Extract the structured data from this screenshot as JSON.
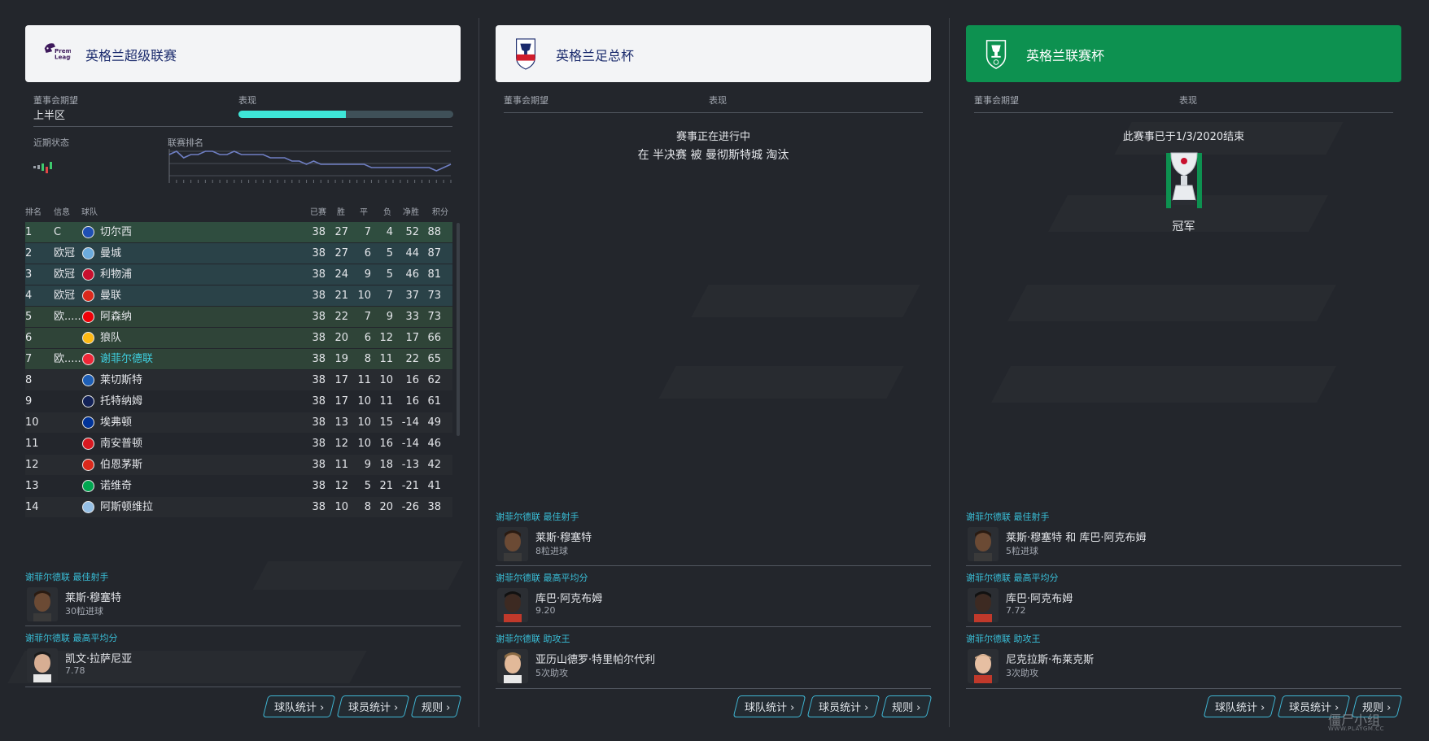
{
  "colors": {
    "background": "#23262c",
    "header_light": "#f3f4f6",
    "header_green": "#0d9150",
    "accent_cyan": "#3ee6d8",
    "section_title_blue": "#39bfd8",
    "highlight_row_green": "#2f4d3f",
    "highlight_row_teal": "#2a4248"
  },
  "premier_league": {
    "title": "英格兰超级联赛",
    "logo_text": "Premier League",
    "board_expectation_label": "董事会期望",
    "board_expectation_value": "上半区",
    "performance_label": "表现",
    "performance_fraction": 0.5,
    "recent_form_label": "近期状态",
    "league_position_label": "联赛排名",
    "position_history": [
      2,
      1,
      3,
      2,
      2,
      1,
      1,
      2,
      2,
      1,
      2,
      2,
      2,
      2,
      3,
      3,
      3,
      4,
      4,
      5,
      4,
      5,
      5,
      5,
      5,
      5,
      5,
      5,
      6,
      6,
      6,
      6,
      6,
      6,
      6,
      6,
      6,
      7,
      6,
      5
    ],
    "table_headers": {
      "pos": "排名",
      "info": "信息",
      "team": "球队",
      "played": "已赛",
      "won": "胜",
      "drawn": "平",
      "lost": "负",
      "gd": "净胜",
      "pts": "积分"
    },
    "table_rows": [
      {
        "pos": "1",
        "info": "C",
        "team": "切尔西",
        "played": "38",
        "won": "27",
        "drawn": "7",
        "lost": "4",
        "gd": "52",
        "pts": "88",
        "badge_color": "#1f4fb3"
      },
      {
        "pos": "2",
        "info": "欧冠",
        "team": "曼城",
        "played": "38",
        "won": "27",
        "drawn": "6",
        "lost": "5",
        "gd": "44",
        "pts": "87",
        "badge_color": "#6cabdd"
      },
      {
        "pos": "3",
        "info": "欧冠",
        "team": "利物浦",
        "played": "38",
        "won": "24",
        "drawn": "9",
        "lost": "5",
        "gd": "46",
        "pts": "81",
        "badge_color": "#c8102e"
      },
      {
        "pos": "4",
        "info": "欧冠",
        "team": "曼联",
        "played": "38",
        "won": "21",
        "drawn": "10",
        "lost": "7",
        "gd": "37",
        "pts": "73",
        "badge_color": "#da291c"
      },
      {
        "pos": "5",
        "info": "欧.....",
        "team": "阿森纳",
        "played": "38",
        "won": "22",
        "drawn": "7",
        "lost": "9",
        "gd": "33",
        "pts": "73",
        "badge_color": "#ef0107"
      },
      {
        "pos": "6",
        "info": "",
        "team": "狼队",
        "played": "38",
        "won": "20",
        "drawn": "6",
        "lost": "12",
        "gd": "17",
        "pts": "66",
        "badge_color": "#fdb913"
      },
      {
        "pos": "7",
        "info": "欧.....",
        "team": "谢菲尔德联",
        "played": "38",
        "won": "19",
        "drawn": "8",
        "lost": "11",
        "gd": "22",
        "pts": "65",
        "badge_color": "#ee2737"
      },
      {
        "pos": "8",
        "info": "",
        "team": "莱切斯特",
        "played": "38",
        "won": "17",
        "drawn": "11",
        "lost": "10",
        "gd": "16",
        "pts": "62",
        "badge_color": "#1e5fb6"
      },
      {
        "pos": "9",
        "info": "",
        "team": "托特纳姆",
        "played": "38",
        "won": "17",
        "drawn": "10",
        "lost": "11",
        "gd": "16",
        "pts": "61",
        "badge_color": "#132257"
      },
      {
        "pos": "10",
        "info": "",
        "team": "埃弗顿",
        "played": "38",
        "won": "13",
        "drawn": "10",
        "lost": "15",
        "gd": "-14",
        "pts": "49",
        "badge_color": "#003399"
      },
      {
        "pos": "11",
        "info": "",
        "team": "南安普顿",
        "played": "38",
        "won": "12",
        "drawn": "10",
        "lost": "16",
        "gd": "-14",
        "pts": "46",
        "badge_color": "#d71920"
      },
      {
        "pos": "12",
        "info": "",
        "team": "伯恩茅斯",
        "played": "38",
        "won": "11",
        "drawn": "9",
        "lost": "18",
        "gd": "-13",
        "pts": "42",
        "badge_color": "#da291c"
      },
      {
        "pos": "13",
        "info": "",
        "team": "诺维奇",
        "played": "38",
        "won": "12",
        "drawn": "5",
        "lost": "21",
        "gd": "-21",
        "pts": "41",
        "badge_color": "#00a650"
      },
      {
        "pos": "14",
        "info": "",
        "team": "阿斯顿维拉",
        "played": "38",
        "won": "10",
        "drawn": "8",
        "lost": "20",
        "gd": "-26",
        "pts": "38",
        "badge_color": "#95bfe5"
      }
    ],
    "top_scorer_title": "谢菲尔德联 最佳射手",
    "top_scorer_name": "莱斯·穆塞特",
    "top_scorer_stat": "30粒进球",
    "top_rating_title": "谢菲尔德联 最高平均分",
    "top_rating_name": "凯文·拉萨尼亚",
    "top_rating_stat": "7.78",
    "buttons": [
      "球队统计",
      "球员统计",
      "规则"
    ]
  },
  "fa_cup": {
    "title": "英格兰足总杯",
    "board_expectation_label": "董事会期望",
    "performance_label": "表现",
    "status_line1": "赛事正在进行中",
    "status_line2": "在 半决赛 被 曼彻斯特城 淘汰",
    "top_scorer_title": "谢菲尔德联 最佳射手",
    "top_scorer_name": "莱斯·穆塞特",
    "top_scorer_stat": "8粒进球",
    "top_rating_title": "谢菲尔德联 最高平均分",
    "top_rating_name": "库巴·阿克布姆",
    "top_rating_stat": "9.20",
    "top_assist_title": "谢菲尔德联 助攻王",
    "top_assist_name": "亚历山德罗·特里帕尔代利",
    "top_assist_stat": "5次助攻",
    "buttons": [
      "球队统计",
      "球员统计",
      "规则"
    ]
  },
  "league_cup": {
    "title": "英格兰联赛杯",
    "board_expectation_label": "董事会期望",
    "performance_label": "表现",
    "status_line1": "此赛事已于1/3/2020结束",
    "result": "冠军",
    "top_scorer_title": "谢菲尔德联 最佳射手",
    "top_scorer_name": "莱斯·穆塞特 和 库巴·阿克布姆",
    "top_scorer_stat": "5粒进球",
    "top_rating_title": "谢菲尔德联 最高平均分",
    "top_rating_name": "库巴·阿克布姆",
    "top_rating_stat": "7.72",
    "top_assist_title": "谢菲尔德联 助攻王",
    "top_assist_name": "尼克拉斯·布莱克斯",
    "top_assist_stat": "3次助攻",
    "buttons": [
      "球队统计",
      "球员统计",
      "规则"
    ]
  },
  "watermark": {
    "text": "僵尸小组",
    "url": "WWW.PLAYGM.CC"
  }
}
